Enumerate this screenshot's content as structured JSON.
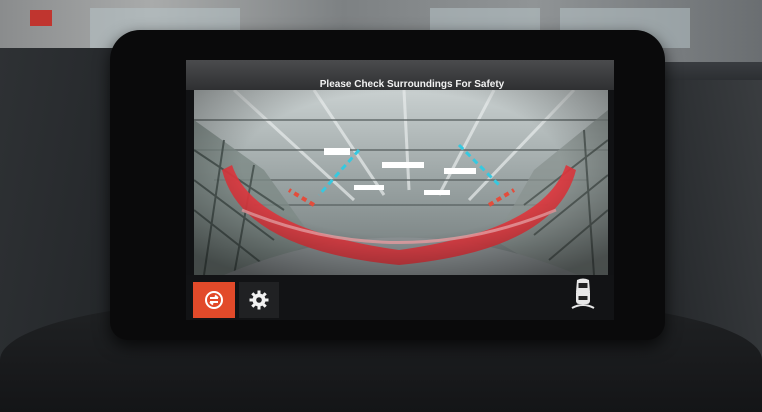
{
  "screen": {
    "title": "Please Check Surroundings For Safety"
  },
  "controls": {
    "camera_view_icon": "camera-view-icon",
    "settings_icon": "gear-icon",
    "vehicle_icon": "car-top-view-icon"
  },
  "colors": {
    "accent": "#e24a2a",
    "guide_red": "#e0383f",
    "guide_cyan": "#36c9e0"
  }
}
